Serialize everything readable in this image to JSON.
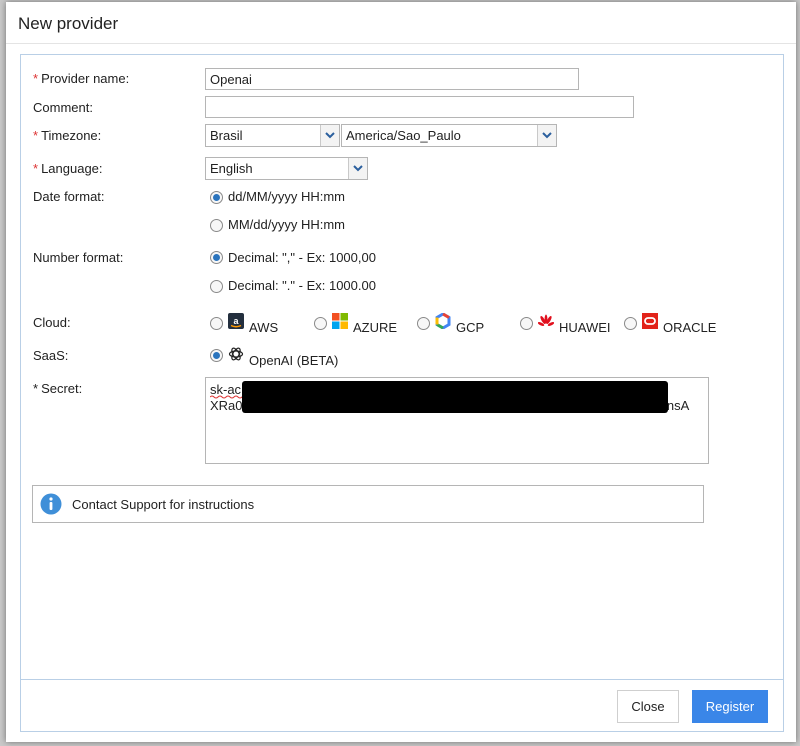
{
  "dialog": {
    "title": "New provider"
  },
  "form": {
    "provider_name": {
      "required_mark": "*",
      "label": "Provider name:",
      "value": "Openai"
    },
    "comment": {
      "label": "Comment:",
      "value": ""
    },
    "timezone": {
      "required_mark": "*",
      "label": "Timezone:",
      "region": "Brasil",
      "zone": "America/Sao_Paulo"
    },
    "language": {
      "required_mark": "*",
      "label": "Language:",
      "value": "English"
    },
    "date_format": {
      "label": "Date format:",
      "options": [
        "dd/MM/yyyy HH:mm",
        "MM/dd/yyyy HH:mm"
      ],
      "selected": "dd/MM/yyyy HH:mm"
    },
    "number_format": {
      "label": "Number format:",
      "options": [
        "Decimal: \",\" - Ex: 1000,00",
        "Decimal: \".\" - Ex: 1000.00"
      ],
      "selected": "Decimal: \",\" - Ex: 1000,00"
    },
    "cloud": {
      "label": "Cloud:",
      "options": [
        {
          "name": "AWS",
          "icon": "aws-icon"
        },
        {
          "name": "AZURE",
          "icon": "azure-icon"
        },
        {
          "name": "GCP",
          "icon": "gcp-icon"
        },
        {
          "name": "HUAWEI",
          "icon": "huawei-icon"
        },
        {
          "name": "ORACLE",
          "icon": "oracle-icon"
        }
      ],
      "selected": null
    },
    "saas": {
      "label": "SaaS:",
      "option": "OpenAI (BETA)",
      "icon": "openai-icon",
      "selected": true
    },
    "secret": {
      "required_mark": "*",
      "label": "Secret:",
      "line1_visible": "sk-ac",
      "line2_visible_start": "XRa0f",
      "line2_visible_end": "lnsA",
      "redacted": true
    }
  },
  "info": {
    "icon": "info-icon",
    "text": "Contact Support for instructions"
  },
  "buttons": {
    "close": "Close",
    "register": "Register"
  },
  "colors": {
    "accent": "#3a86e8",
    "required": "#dd3333",
    "panel_border": "#b9cfe6"
  }
}
